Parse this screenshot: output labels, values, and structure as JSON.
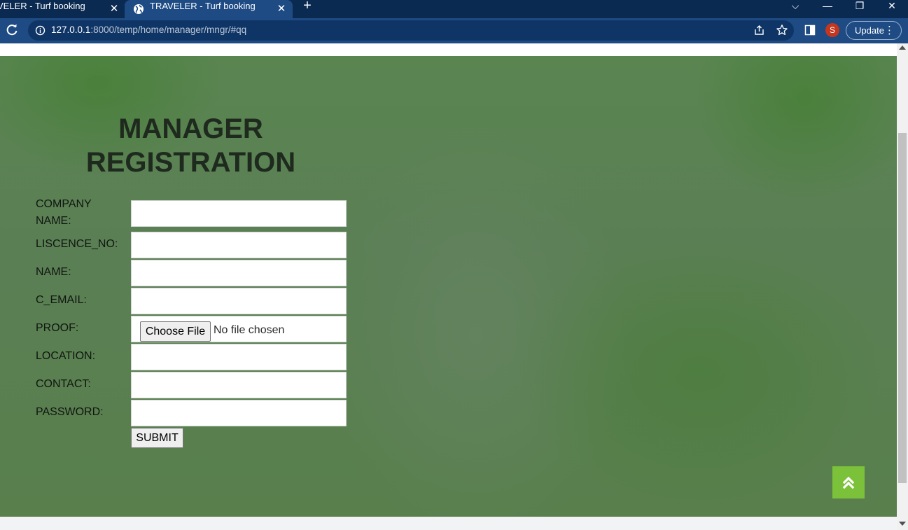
{
  "browser": {
    "tabs": [
      {
        "title": "VELER - Turf booking",
        "active": false
      },
      {
        "title": "TRAVELER - Turf booking",
        "active": true
      }
    ],
    "tab_close_glyph": "✕",
    "new_tab_glyph": "+",
    "url_host": "127.0.0.1",
    "url_rest": ":8000/temp/home/manager/mngr/#qq",
    "profile_initial": "S",
    "update_label": "Update",
    "menu_glyph": "⋮",
    "window_controls": {
      "list": "⌵",
      "minimize": "—",
      "restore": "❐",
      "close": "✕"
    }
  },
  "page": {
    "title": "MANAGER REGISTRATION",
    "fields": [
      {
        "label": "COMPANY NAME:",
        "type": "text",
        "value": ""
      },
      {
        "label": "LISCENCE_NO:",
        "type": "text",
        "value": ""
      },
      {
        "label": "NAME:",
        "type": "text",
        "value": ""
      },
      {
        "label": "C_EMAIL:",
        "type": "text",
        "value": ""
      },
      {
        "label": "PROOF:",
        "type": "file",
        "button_label": "Choose File",
        "status": "No file chosen"
      },
      {
        "label": "LOCATION:",
        "type": "text",
        "value": ""
      },
      {
        "label": "CONTACT:",
        "type": "text",
        "value": ""
      },
      {
        "label": "PASSWORD:",
        "type": "password",
        "value": ""
      }
    ],
    "submit_label": "SUBMIT",
    "scroll_top_icon": "double-chevron-up-icon"
  },
  "colors": {
    "tab_strip": "#0b2a52",
    "toolbar": "#1e4b84",
    "hero_green": "#5a8551",
    "scroll_top_button": "#7cc13a",
    "avatar": "#c5361f"
  }
}
